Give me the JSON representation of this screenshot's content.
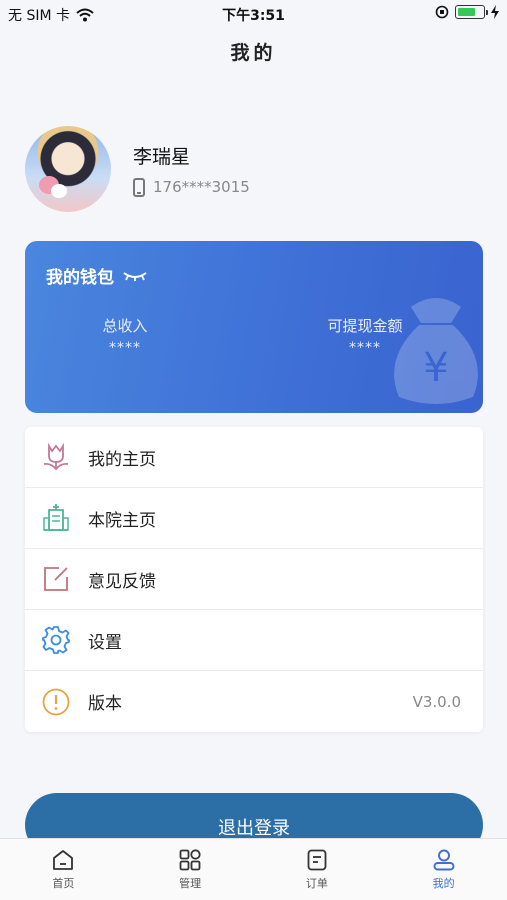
{
  "status_bar": {
    "carrier": "无 SIM 卡",
    "time": "下午3:51"
  },
  "header": {
    "title": "我的"
  },
  "profile": {
    "name": "李瑞星",
    "phone": "176****3015"
  },
  "wallet": {
    "title": "我的钱包",
    "total_income_label": "总收入",
    "total_income_value": "****",
    "withdrawable_label": "可提现金额",
    "withdrawable_value": "****",
    "gradient_colors": [
      "#4a86de",
      "#3a63cf"
    ]
  },
  "menu": {
    "items": [
      {
        "label": "我的主页",
        "icon": "tulip-icon",
        "color": "#c07a9a"
      },
      {
        "label": "本院主页",
        "icon": "hospital-icon",
        "color": "#4fb69a"
      },
      {
        "label": "意见反馈",
        "icon": "edit-icon",
        "color": "#c0737a"
      },
      {
        "label": "设置",
        "icon": "gear-icon",
        "color": "#3a8ee6"
      },
      {
        "label": "版本",
        "icon": "info-icon",
        "color": "#e8a33a",
        "value": "V3.0.0"
      }
    ]
  },
  "logout_button": {
    "label": "退出登录",
    "color": "#2b6fa6"
  },
  "tabbar": {
    "active_color": "#3e6fd6",
    "items": [
      {
        "label": "首页",
        "icon": "home-icon"
      },
      {
        "label": "管理",
        "icon": "grid-icon"
      },
      {
        "label": "订单",
        "icon": "order-icon"
      },
      {
        "label": "我的",
        "icon": "user-icon",
        "active": true
      }
    ]
  }
}
